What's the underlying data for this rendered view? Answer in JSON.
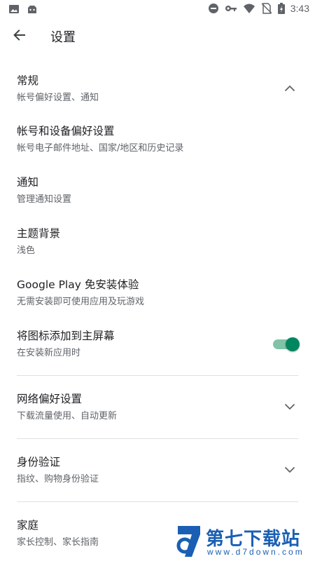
{
  "status_bar": {
    "left_icons": [
      "image-icon",
      "android-icon"
    ],
    "right_icons": [
      "do-not-disturb-icon",
      "vpn-key-icon",
      "wifi-icon",
      "no-sim-icon",
      "battery-icon"
    ],
    "time": "3:43"
  },
  "app_bar": {
    "back_icon": "arrow-back-icon",
    "title": "设置"
  },
  "settings": {
    "general": {
      "title": "常规",
      "subtitle": "帐号偏好设置、通知",
      "trail_icon": "chevron-up-icon"
    },
    "account": {
      "title": "帐号和设备偏好设置",
      "subtitle": "帐号电子邮件地址、国家/地区和历史记录"
    },
    "notifications": {
      "title": "通知",
      "subtitle": "管理通知设置"
    },
    "theme": {
      "title": "主题背景",
      "subtitle": "浅色"
    },
    "instant": {
      "title": "Google Play 免安装体验",
      "subtitle": "无需安装即可使用应用及玩游戏"
    },
    "add_icon": {
      "title": "将图标添加到主屏幕",
      "subtitle": "在安装新应用时",
      "toggle_on": true
    },
    "network": {
      "title": "网络偏好设置",
      "subtitle": "下载流量使用、自动更新",
      "trail_icon": "chevron-down-icon"
    },
    "auth": {
      "title": "身份验证",
      "subtitle": "指纹、购物身份验证",
      "trail_icon": "chevron-down-icon"
    },
    "family": {
      "title": "家庭",
      "subtitle": "家长控制、家长指南"
    }
  },
  "watermark": {
    "name": "第七下载站",
    "url": "www.d7down.com"
  },
  "colors": {
    "accent": "#01875f",
    "accent_track": "#81c3a8",
    "text_primary": "#202124",
    "text_secondary": "#5f6368",
    "divider": "#e0e0e0",
    "watermark": "#1a5fb4"
  }
}
